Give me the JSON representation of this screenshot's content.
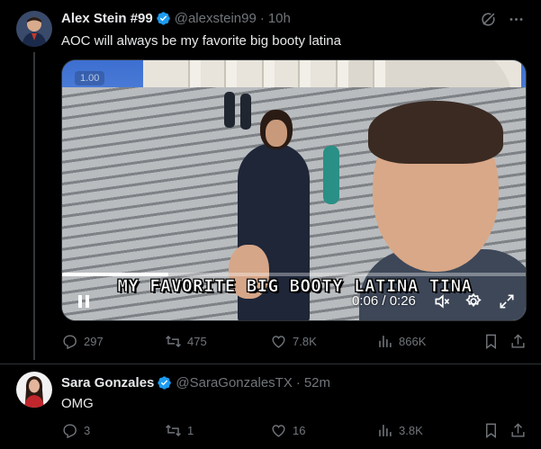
{
  "tweet1": {
    "display_name": "Alex Stein #99",
    "handle": "@alexstein99",
    "separator": "·",
    "time": "10h",
    "text": "AOC will always be my favorite big booty latina",
    "media": {
      "gif_badge": "1.00",
      "caption": "MY FAVORITE BIG BOOTY LATINA TINA",
      "time_display": "0:06 / 0:26",
      "progress": 0.23
    },
    "stats": {
      "replies": "297",
      "reposts": "475",
      "likes": "7.8K",
      "views": "866K"
    }
  },
  "tweet2": {
    "display_name": "Sara Gonzales",
    "handle": "@SaraGonzalesTX",
    "separator": "·",
    "time": "52m",
    "text": "OMG",
    "stats": {
      "replies": "3",
      "reposts": "1",
      "likes": "16",
      "views": "3.8K"
    }
  },
  "colors": {
    "background": "#000000",
    "text_primary": "#e7e9ea",
    "text_secondary": "#71767b",
    "verified": "#1d9bf0",
    "divider": "#2f3336"
  },
  "icons": [
    "grok-icon",
    "more-icon",
    "reply-icon",
    "repost-icon",
    "like-icon",
    "views-icon",
    "bookmark-icon",
    "share-icon",
    "play-pause-icon",
    "mute-icon",
    "settings-icon",
    "fullscreen-icon",
    "verified-badge-icon"
  ]
}
